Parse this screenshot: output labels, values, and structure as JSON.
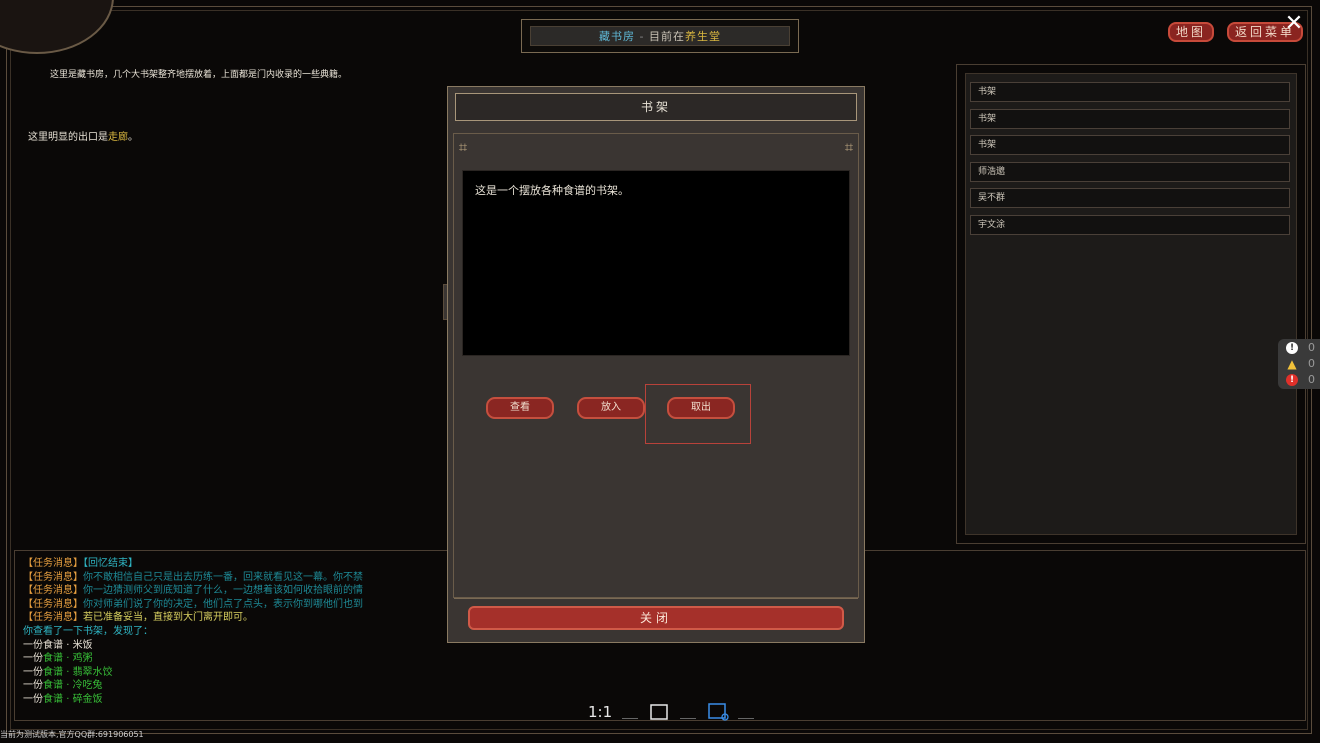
{
  "header": {
    "room": "藏书房",
    "separator": "-",
    "current_label": "目前在",
    "location": "养生堂"
  },
  "top_buttons": {
    "map": "地图",
    "return": "返回菜单"
  },
  "room": {
    "description": "这里是藏书房，几个大书架整齐地摆放着，上面都是门内收录的一些典籍。",
    "exits_prefix": "这里明显的出口是",
    "exit_name": "走廊",
    "exits_suffix": "。"
  },
  "object_list": [
    "书架",
    "书架",
    "书架",
    "师浩邈",
    "吴不群",
    "宇文涂"
  ],
  "status": [
    {
      "icon": "info-icon",
      "count": "0",
      "color": "#ffffff"
    },
    {
      "icon": "warning-icon",
      "count": "0",
      "color": "#f2c23a"
    },
    {
      "icon": "error-icon",
      "count": "0",
      "color": "#e0302a"
    }
  ],
  "log": {
    "l1_tag": "【任务消息】",
    "l1_text": "【回忆结束】",
    "l2_tag": "【任务消息】",
    "l2_text": "你不敢相信自己只是出去历练一番，回来就看见这一幕。你不禁",
    "l3_tag": "【任务消息】",
    "l3_text": "你一边猜测师父到底知道了什么，一边想着该如何收拾眼前的情",
    "l4_tag": "【任务消息】",
    "l4_text": "你对师弟们说了你的决定，他们点了点头，表示你到哪他们也到",
    "l5_tag": "【任务消息】",
    "l5_text": "若已准备妥当，直接到大门离开即可。",
    "l6": "你查看了一下书架，发现了：",
    "items_prefix": "一份",
    "items": [
      {
        "a": "食谱",
        "sep": "·",
        "b": "米饭",
        "color": "white"
      },
      {
        "a": "食谱",
        "sep": "·",
        "b": "鸡粥",
        "color": "green"
      },
      {
        "a": "食谱",
        "sep": "·",
        "b": "翡翠水饺",
        "color": "green"
      },
      {
        "a": "食谱",
        "sep": "·",
        "b": "冷吃兔",
        "color": "green"
      },
      {
        "a": "食谱",
        "sep": "·",
        "b": "碎金饭",
        "color": "green"
      }
    ]
  },
  "modal": {
    "title": "书架",
    "text": "这是一个摆放各种食谱的书架。",
    "buttons": {
      "view": "查看",
      "put": "放入",
      "take": "取出"
    },
    "close": "关闭"
  },
  "toolbar": {
    "ratio": "1:1"
  },
  "version": "当前为测试版本,官方QQ群:691906051",
  "colors": {
    "accent_red": "#a5302a",
    "location_yellow": "#d8b640",
    "room_cyan": "#5fb8d6"
  }
}
